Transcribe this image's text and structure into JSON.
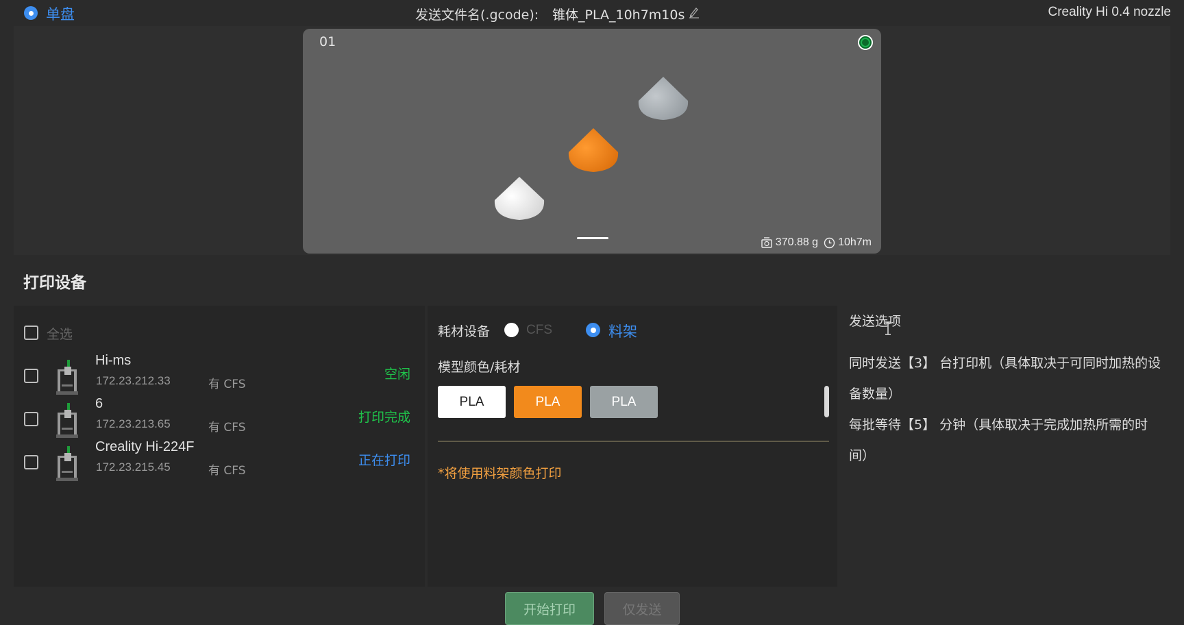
{
  "header": {
    "mode_label": "单盘",
    "file_label": "发送文件名(.gcode):",
    "file_name": "锥体_PLA_10h7m10s",
    "printer_model": "Creality Hi 0.4 nozzle"
  },
  "preview": {
    "plate_index": "01",
    "weight": "370.88 g",
    "time": "10h7m",
    "model_colors": [
      "#9aa0a6",
      "#f07f14",
      "#e8e8e8"
    ]
  },
  "devices": {
    "title": "打印设备",
    "select_all": "全选",
    "list": [
      {
        "name": "Hi-ms",
        "ip": "172.23.212.33",
        "cfs": "有 CFS",
        "status": "空闲",
        "status_color": "#1fc24a"
      },
      {
        "name": "6",
        "ip": "172.23.213.65",
        "cfs": "有 CFS",
        "status": "打印完成",
        "status_color": "#1fc24a"
      },
      {
        "name": "Creality Hi-224F",
        "ip": "172.23.215.45",
        "cfs": "有 CFS",
        "status": "正在打印",
        "status_color": "#3d8ef0"
      }
    ]
  },
  "material": {
    "device_label": "耗材设备",
    "option_cfs": "CFS",
    "option_rack": "料架",
    "color_label": "模型颜色/耗材",
    "chips": [
      "PLA",
      "PLA",
      "PLA"
    ],
    "chip_colors": [
      "#ffffff",
      "#f28a1c",
      "#9aa1a3"
    ],
    "note": "*将使用料架颜色打印"
  },
  "options": {
    "title": "发送选项",
    "line1": "同时发送【3】 台打印机（具体取决于可同时加热的设备数量）",
    "line2": "每批等待【5】 分钟（具体取决于完成加热所需的时间）"
  },
  "actions": {
    "start_print": "开始打印",
    "send_only": "仅发送"
  }
}
